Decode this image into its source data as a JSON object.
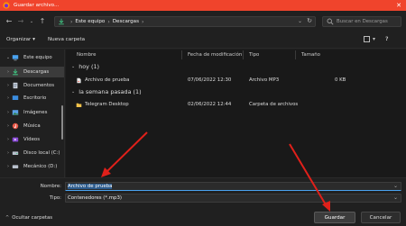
{
  "window": {
    "title": "Guardar archivo..."
  },
  "address": {
    "crumbs": [
      "Este equipo",
      "Descargas"
    ]
  },
  "search": {
    "placeholder": "Buscar en Descargas"
  },
  "toolbar": {
    "organize": "Organizar",
    "new_folder": "Nueva carpeta"
  },
  "sidebar": {
    "items": [
      {
        "label": "Este equipo",
        "icon": "pc-icon"
      },
      {
        "label": "Descargas",
        "icon": "download-icon"
      },
      {
        "label": "Documentos",
        "icon": "documents-icon"
      },
      {
        "label": "Escritorio",
        "icon": "desktop-icon"
      },
      {
        "label": "Imágenes",
        "icon": "pictures-icon"
      },
      {
        "label": "Música",
        "icon": "music-icon"
      },
      {
        "label": "Vídeos",
        "icon": "videos-icon"
      },
      {
        "label": "Disco local (C:)",
        "icon": "drive-icon"
      },
      {
        "label": "Mecánico (D:)",
        "icon": "drive-icon"
      }
    ]
  },
  "columns": {
    "name": "Nombre",
    "date": "Fecha de modificación",
    "type": "Tipo",
    "size": "Tamaño"
  },
  "groups": [
    {
      "label": "hoy (1)",
      "rows": [
        {
          "name": "Archivo de prueba",
          "date": "07/06/2022 12:30",
          "type": "Archivo MP3",
          "size": "0 KB"
        }
      ]
    },
    {
      "label": "la semana pasada (1)",
      "rows": [
        {
          "name": "Telegram Desktop",
          "date": "02/06/2022 12:44",
          "type": "Carpeta de archivos",
          "size": ""
        }
      ]
    }
  ],
  "form": {
    "name_label": "Nombre:",
    "name_value": "Archivo de prueba",
    "type_label": "Tipo:",
    "type_value": "Contenedores (*.mp3)"
  },
  "footer": {
    "hide_folders": "Ocultar carpetas",
    "save": "Guardar",
    "cancel": "Cancelar"
  },
  "colors": {
    "titlebar": "#f0442c",
    "folder": "#f3c24a",
    "accent": "#4aa3f0",
    "annotation": "#e0201a"
  }
}
